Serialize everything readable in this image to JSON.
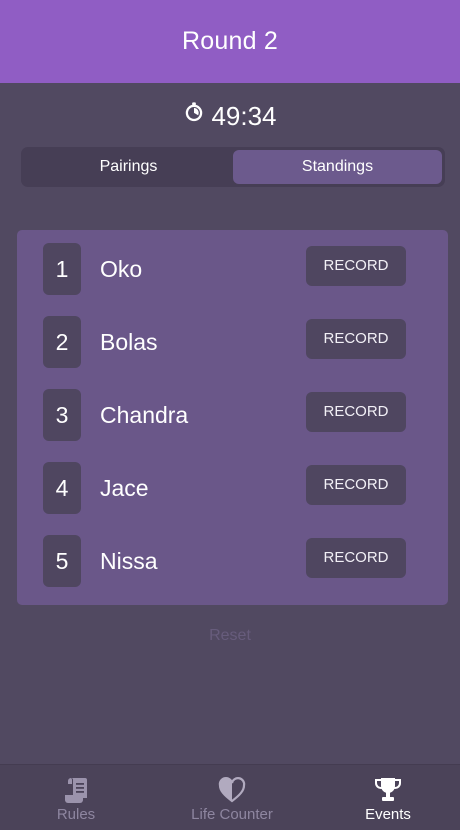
{
  "header": {
    "title": "Round 2"
  },
  "timer": {
    "value": "49:34",
    "icon": "stopwatch-icon"
  },
  "tabs": [
    {
      "label": "Pairings",
      "active": false
    },
    {
      "label": "Standings",
      "active": true
    }
  ],
  "standings": [
    {
      "rank": "1",
      "name": "Oko",
      "action": "RECORD"
    },
    {
      "rank": "2",
      "name": "Bolas",
      "action": "RECORD"
    },
    {
      "rank": "3",
      "name": "Chandra",
      "action": "RECORD"
    },
    {
      "rank": "4",
      "name": "Jace",
      "action": "RECORD"
    },
    {
      "rank": "5",
      "name": "Nissa",
      "action": "RECORD"
    }
  ],
  "reset_label": "Reset",
  "bottom_nav": [
    {
      "label": "Rules",
      "icon": "scroll-icon",
      "active": false
    },
    {
      "label": "Life Counter",
      "icon": "heart-icon",
      "active": false
    },
    {
      "label": "Events",
      "icon": "trophy-icon",
      "active": true
    }
  ],
  "colors": {
    "header": "#905dc4",
    "background": "#514961",
    "panel": "#6a5789",
    "chip": "#4f4660"
  }
}
